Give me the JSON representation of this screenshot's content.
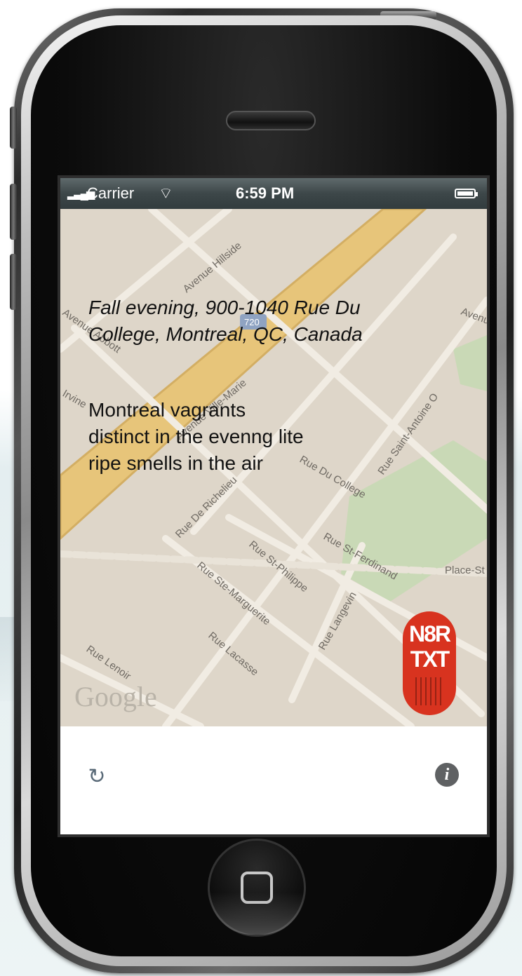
{
  "status_bar": {
    "signal_icon": "signal-bars-icon",
    "carrier": "Carrier",
    "wifi_icon": "wifi-icon",
    "time": "6:59 PM",
    "battery_icon": "battery-icon"
  },
  "map": {
    "street_labels": [
      "Avenue Hillside",
      "Avenue Ville-Marie",
      "Avenue Atwater",
      "Rue De Richelieu",
      "Rue Du College",
      "Rue Saint-Antoine O",
      "Rue St-Ferdinand",
      "Rue St-Philippe",
      "Rue Ste-Marguerite",
      "Rue Langevin",
      "Rue Lacasse",
      "Rue Lenoir",
      "Place-St",
      "Irvine",
      "Avenue Abbott",
      "720"
    ],
    "logo": "Google",
    "colors": {
      "land": "#ded6c9",
      "highway": "#e7c57a",
      "park": "#c9d9b6",
      "street": "#f1ece3"
    }
  },
  "poem": {
    "place_line_1": "Fall evening, 900-1040 Rue Du",
    "place_line_2": "College, Montreal, QC, Canada",
    "verse_line_1": "Montreal vagrants",
    "verse_line_2": "distinct in the evenng lite",
    "verse_line_3": "ripe smells in the air"
  },
  "stamp": {
    "line_1": "N8R",
    "line_2": "TXT",
    "color": "#d8331f"
  },
  "toolbar": {
    "refresh_icon": "refresh-icon",
    "refresh_glyph": "↻",
    "info_icon": "info-icon",
    "info_glyph": "i"
  }
}
